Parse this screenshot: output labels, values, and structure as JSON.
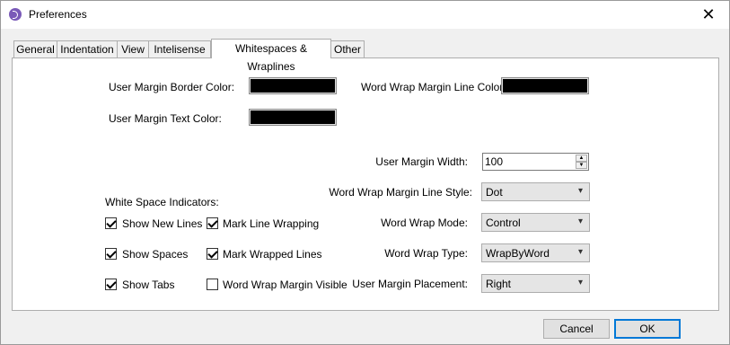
{
  "window": {
    "title": "Preferences",
    "close_glyph": "✕",
    "app_icon": "app-icon"
  },
  "tabs": [
    "General",
    "Indentation",
    "View",
    "Intelisense",
    "Whitespaces & Wraplines",
    "Other"
  ],
  "active_tab": "Whitespaces & Wraplines",
  "colors": {
    "user_margin_border_label": "User Margin Border Color:",
    "user_margin_border_value": "#000000",
    "user_margin_text_label": "User Margin Text Color:",
    "user_margin_text_value": "#000000",
    "word_wrap_margin_line_label": "Word Wrap Margin Line Color:",
    "word_wrap_margin_line_value": "#000000"
  },
  "indicators": {
    "heading": "White Space Indicators:",
    "items": [
      {
        "label": "Show New Lines",
        "checked": true
      },
      {
        "label": "Mark Line Wrapping",
        "checked": true
      },
      {
        "label": "Show Spaces",
        "checked": true
      },
      {
        "label": "Mark Wrapped Lines",
        "checked": true
      },
      {
        "label": "Show Tabs",
        "checked": true
      },
      {
        "label": "Word Wrap Margin Visible",
        "checked": false
      }
    ]
  },
  "settings": {
    "user_margin_width_label": "User Margin Width:",
    "user_margin_width_value": "100",
    "margin_line_style_label": "Word Wrap Margin Line Style:",
    "margin_line_style_value": "Dot",
    "wrap_mode_label": "Word Wrap Mode:",
    "wrap_mode_value": "Control",
    "wrap_type_label": "Word Wrap Type:",
    "wrap_type_value": "WrapByWord",
    "margin_placement_label": "User Margin Placement:",
    "margin_placement_value": "Right"
  },
  "buttons": {
    "cancel": "Cancel",
    "ok": "OK"
  }
}
